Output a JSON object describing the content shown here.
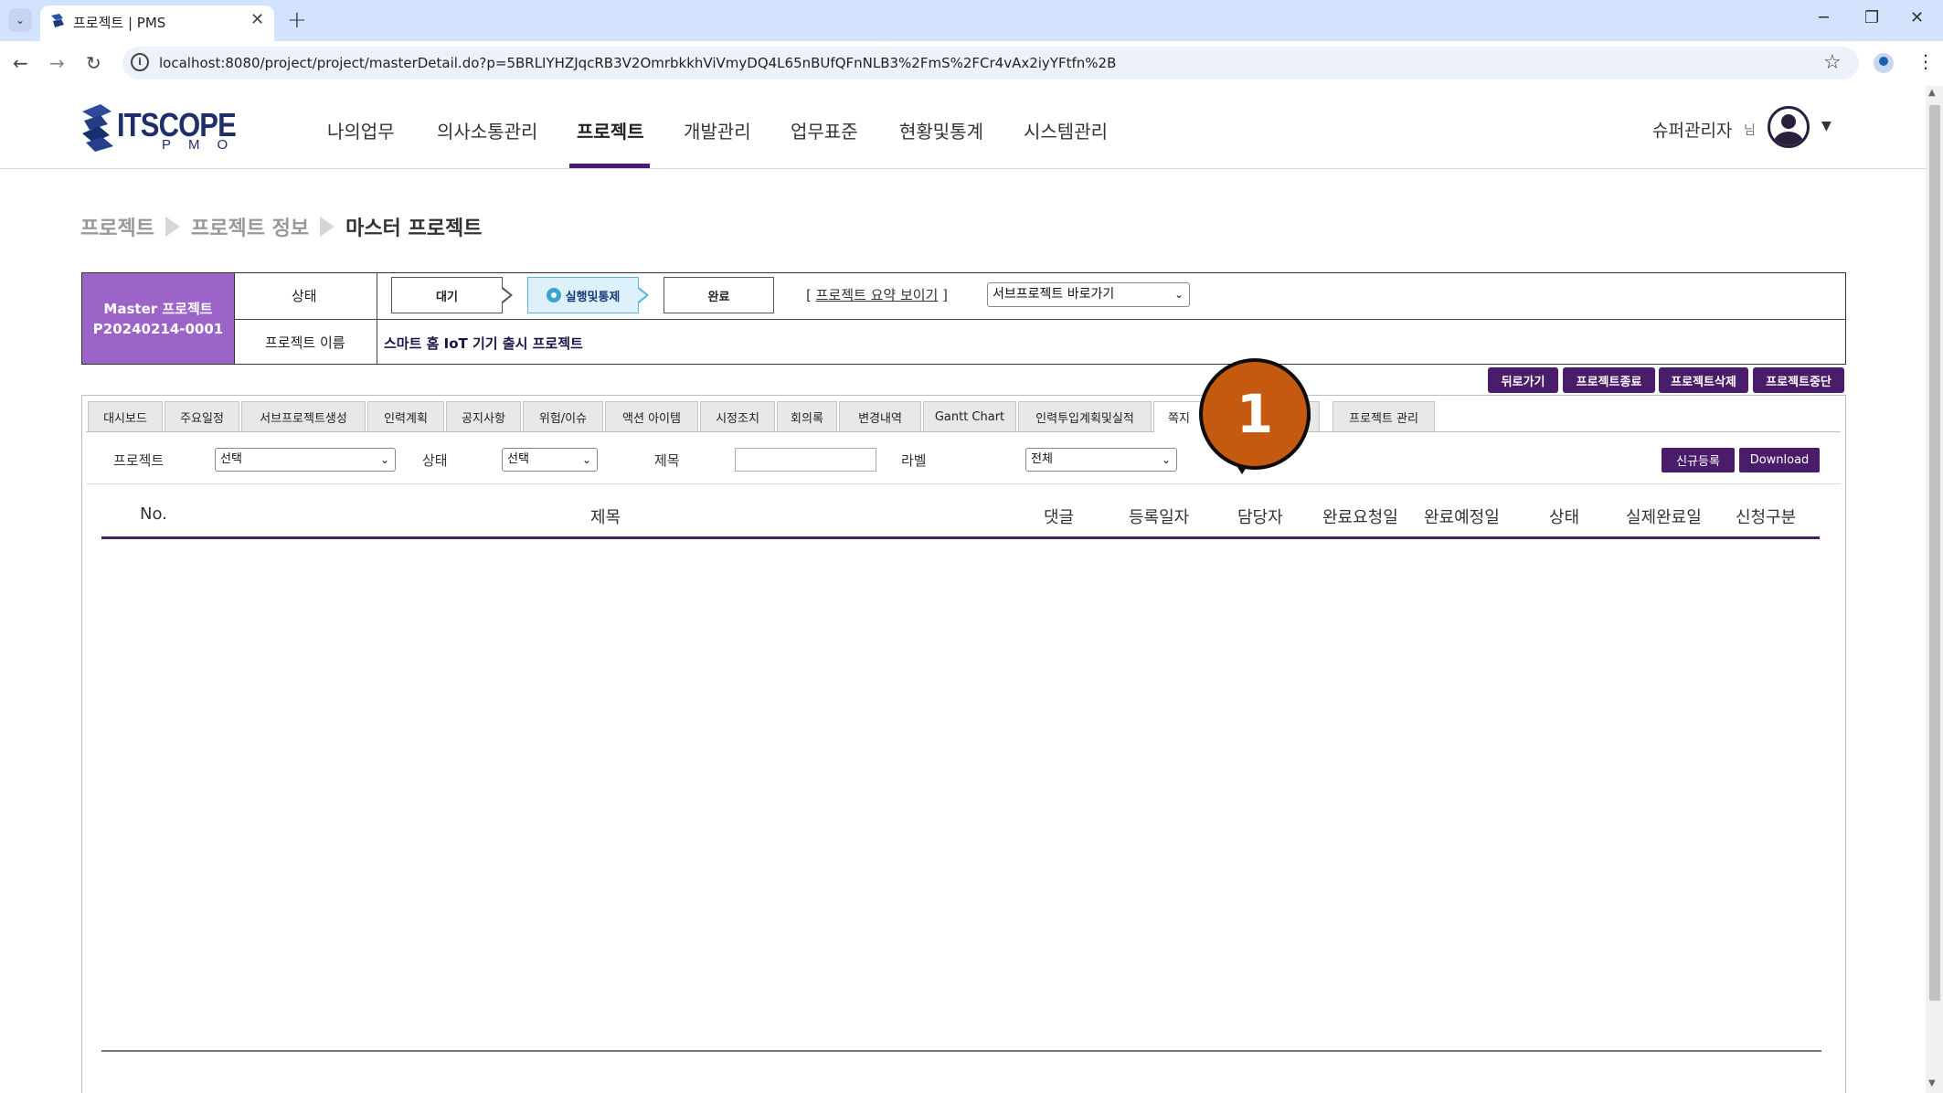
{
  "browser": {
    "tab_title": "프로젝트 | PMS",
    "tab_close": "✕",
    "new_tab": "+",
    "url": "localhost:8080/project/project/masterDetail.do?p=5BRLIYHZJqcRB3V2OmrbkkhViVmyDQ4L65nBUfQFnNLB3%2FmS%2FCr4vAx2iyYFtfn%2B",
    "window_controls": [
      "─",
      "❐",
      "✕"
    ],
    "icons": [
      "tab-list-icon",
      "back-icon",
      "forward-icon",
      "reload-icon",
      "site-info-icon",
      "bookmark-star-icon",
      "profile-icon",
      "kebab-menu-icon"
    ]
  },
  "header": {
    "logo_text": "ITSCOPE",
    "logo_sub": "PMO",
    "nav": [
      "나의업무",
      "의사소통관리",
      "프로젝트",
      "개발관리",
      "업무표준",
      "현황및통계",
      "시스템관리"
    ],
    "active_nav": "프로젝트",
    "user_name": "슈퍼관리자",
    "user_suffix": "님"
  },
  "breadcrumb": [
    "프로젝트",
    "프로젝트 정보",
    "마스터 프로젝트"
  ],
  "project": {
    "type_label": "Master 프로젝트",
    "code": "P20240214-0001",
    "status_label": "상태",
    "steps": [
      "대기",
      "실행및통제",
      "완료"
    ],
    "current_step": "실행및통제",
    "summary_link_open": "[ ",
    "summary_link": "프로젝트 요약 보이기",
    "summary_link_close": " ]",
    "subproject_select": "서브프로젝트 바로가기",
    "name_label": "프로젝트 이름",
    "name": "스마트 홈 IoT 기기 출시 프로젝트"
  },
  "actions": [
    "뒤로가기",
    "프로젝트종료",
    "프로젝트삭제",
    "프로젝트중단"
  ],
  "tabs": [
    "대시보드",
    "주요일정",
    "서브프로젝트생성",
    "인력계획",
    "공지사항",
    "위험/이슈",
    "액션 아이템",
    "시정조치",
    "회의록",
    "변경내역",
    "Gantt Chart",
    "인력투입계획및실적",
    "쪽지",
    "m",
    "프로젝트 관리"
  ],
  "filters": {
    "project_label": "프로젝트",
    "project_value": "선택",
    "status_label": "상태",
    "status_value": "선택",
    "title_label": "제목",
    "title_value": "",
    "label_label": "라벨",
    "label_value": "전체",
    "new_button": "신규등록",
    "download_button": "Download"
  },
  "table": {
    "columns": [
      "No.",
      "제목",
      "댓글",
      "등록일자",
      "담당자",
      "완료요청일",
      "완료예정일",
      "상태",
      "실제완료일",
      "신청구분"
    ],
    "rows": []
  },
  "annotation": {
    "step_number": "1",
    "color": "#c5590f"
  },
  "colors": {
    "brand_purple": "#4a1d6b",
    "master_cell": "#9c64c8",
    "running_step": "#ddf1fa"
  }
}
